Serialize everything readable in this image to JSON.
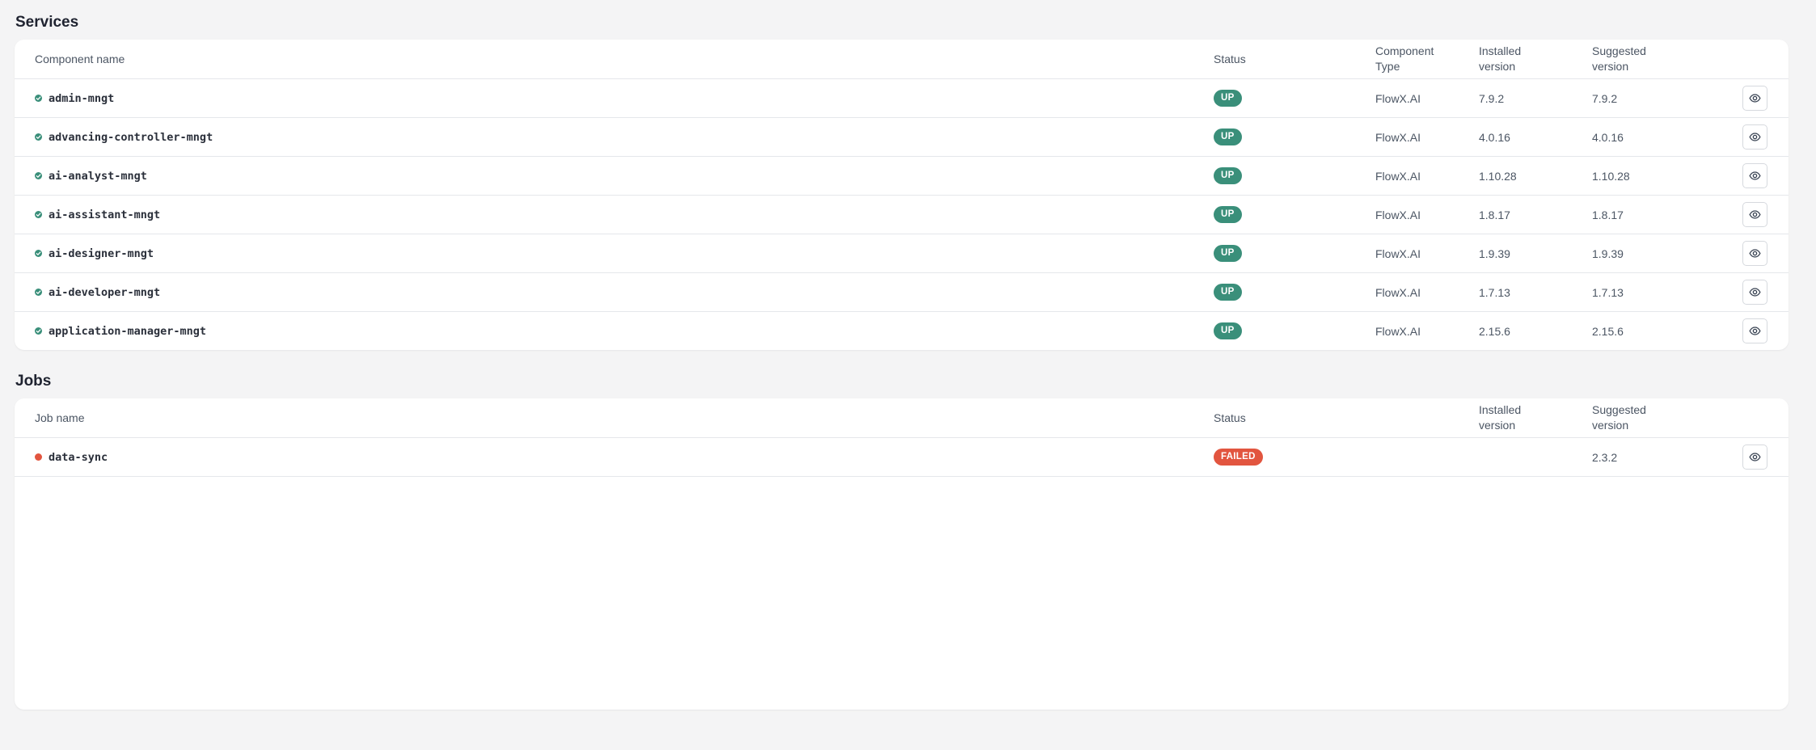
{
  "services": {
    "title": "Services",
    "columns": {
      "name": "Component name",
      "status": "Status",
      "type_l1": "Component",
      "type_l2": "Type",
      "installed_l1": "Installed",
      "installed_l2": "version",
      "suggested_l1": "Suggested",
      "suggested_l2": "version"
    },
    "rows": [
      {
        "name": "admin-mngt",
        "status": "UP",
        "type": "FlowX.AI",
        "installed": "7.9.2",
        "suggested": "7.9.2"
      },
      {
        "name": "advancing-controller-mngt",
        "status": "UP",
        "type": "FlowX.AI",
        "installed": "4.0.16",
        "suggested": "4.0.16"
      },
      {
        "name": "ai-analyst-mngt",
        "status": "UP",
        "type": "FlowX.AI",
        "installed": "1.10.28",
        "suggested": "1.10.28"
      },
      {
        "name": "ai-assistant-mngt",
        "status": "UP",
        "type": "FlowX.AI",
        "installed": "1.8.17",
        "suggested": "1.8.17"
      },
      {
        "name": "ai-designer-mngt",
        "status": "UP",
        "type": "FlowX.AI",
        "installed": "1.9.39",
        "suggested": "1.9.39"
      },
      {
        "name": "ai-developer-mngt",
        "status": "UP",
        "type": "FlowX.AI",
        "installed": "1.7.13",
        "suggested": "1.7.13"
      },
      {
        "name": "application-manager-mngt",
        "status": "UP",
        "type": "FlowX.AI",
        "installed": "2.15.6",
        "suggested": "2.15.6"
      }
    ]
  },
  "jobs": {
    "title": "Jobs",
    "columns": {
      "name": "Job name",
      "status": "Status",
      "installed_l1": "Installed",
      "installed_l2": "version",
      "suggested_l1": "Suggested",
      "suggested_l2": "version"
    },
    "rows": [
      {
        "name": "data-sync",
        "status": "FAILED",
        "installed": "",
        "suggested": "2.3.2"
      }
    ]
  },
  "icons": {
    "status_ok": "check-circle-icon",
    "status_fail": "error-dot-icon",
    "view": "eye-icon"
  },
  "colors": {
    "up": "#3a8f7a",
    "failed": "#e2553f",
    "background": "#f4f4f5"
  }
}
